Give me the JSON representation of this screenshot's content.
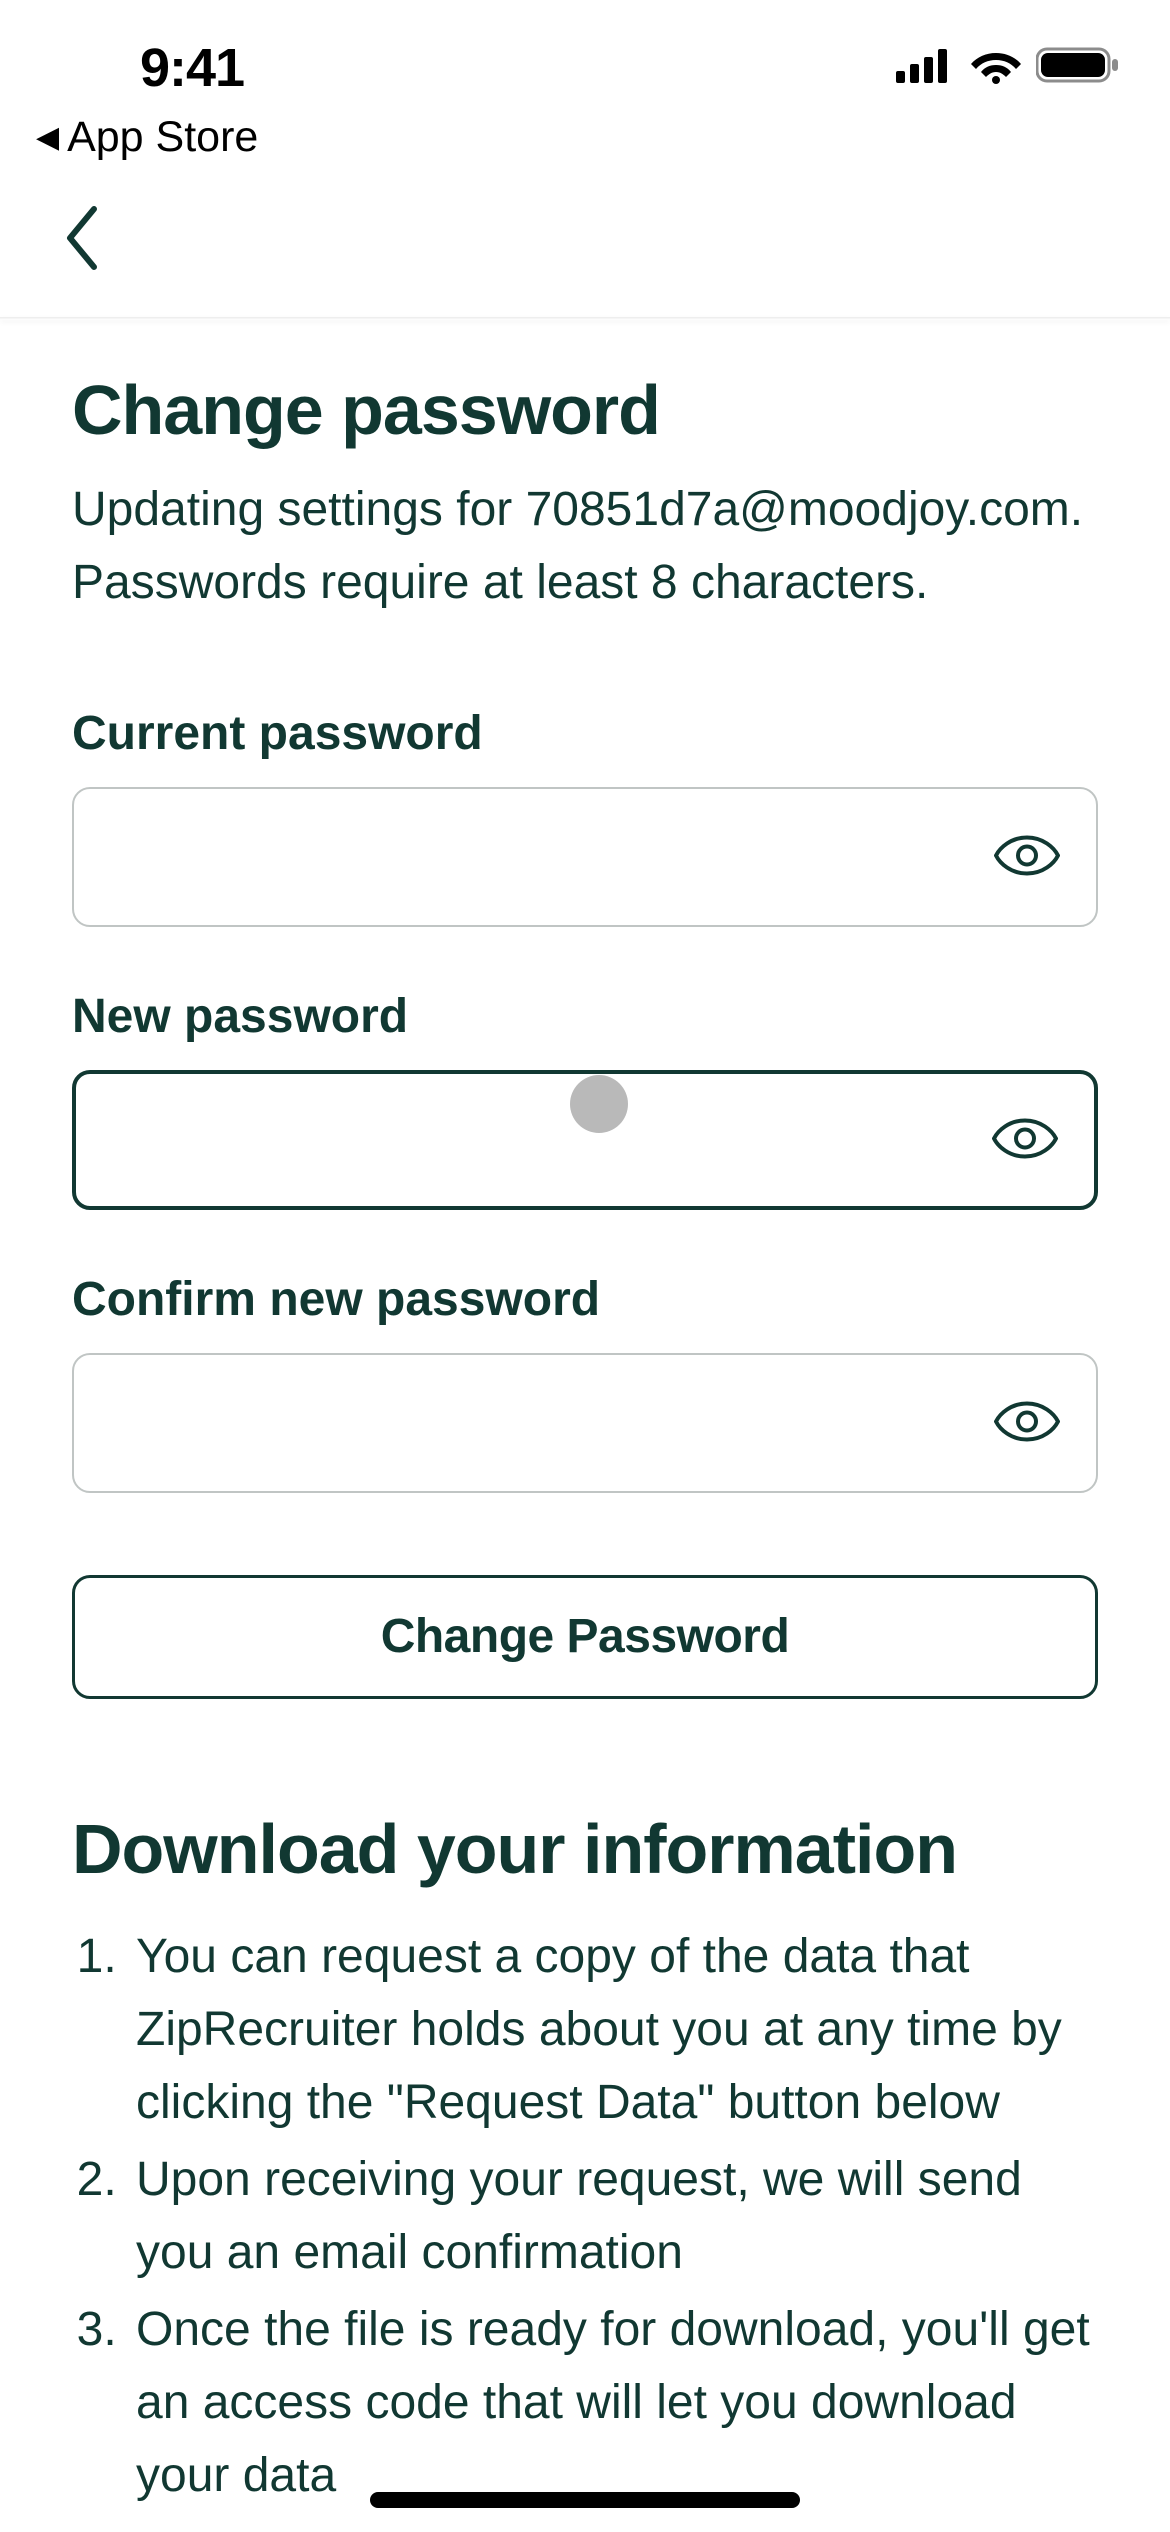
{
  "status": {
    "time": "9:41",
    "back_label": "App Store"
  },
  "page": {
    "title": "Change password",
    "subtitle": "Updating settings for 70851d7a@moodjoy.com. Passwords require at least 8 characters."
  },
  "form": {
    "current": {
      "label": "Current password",
      "value": ""
    },
    "new": {
      "label": "New password",
      "value": ""
    },
    "confirm": {
      "label": "Confirm new password",
      "value": ""
    },
    "submit_label": "Change Password"
  },
  "download": {
    "title": "Download your information",
    "items": [
      "You can request a copy of the data that ZipRecruiter holds about you at any time by clicking the \"Request Data\" button below",
      "Upon receiving your request, we will send you an email confirmation",
      "Once the file is ready for download, you'll get an access code that will let you download your data"
    ]
  }
}
